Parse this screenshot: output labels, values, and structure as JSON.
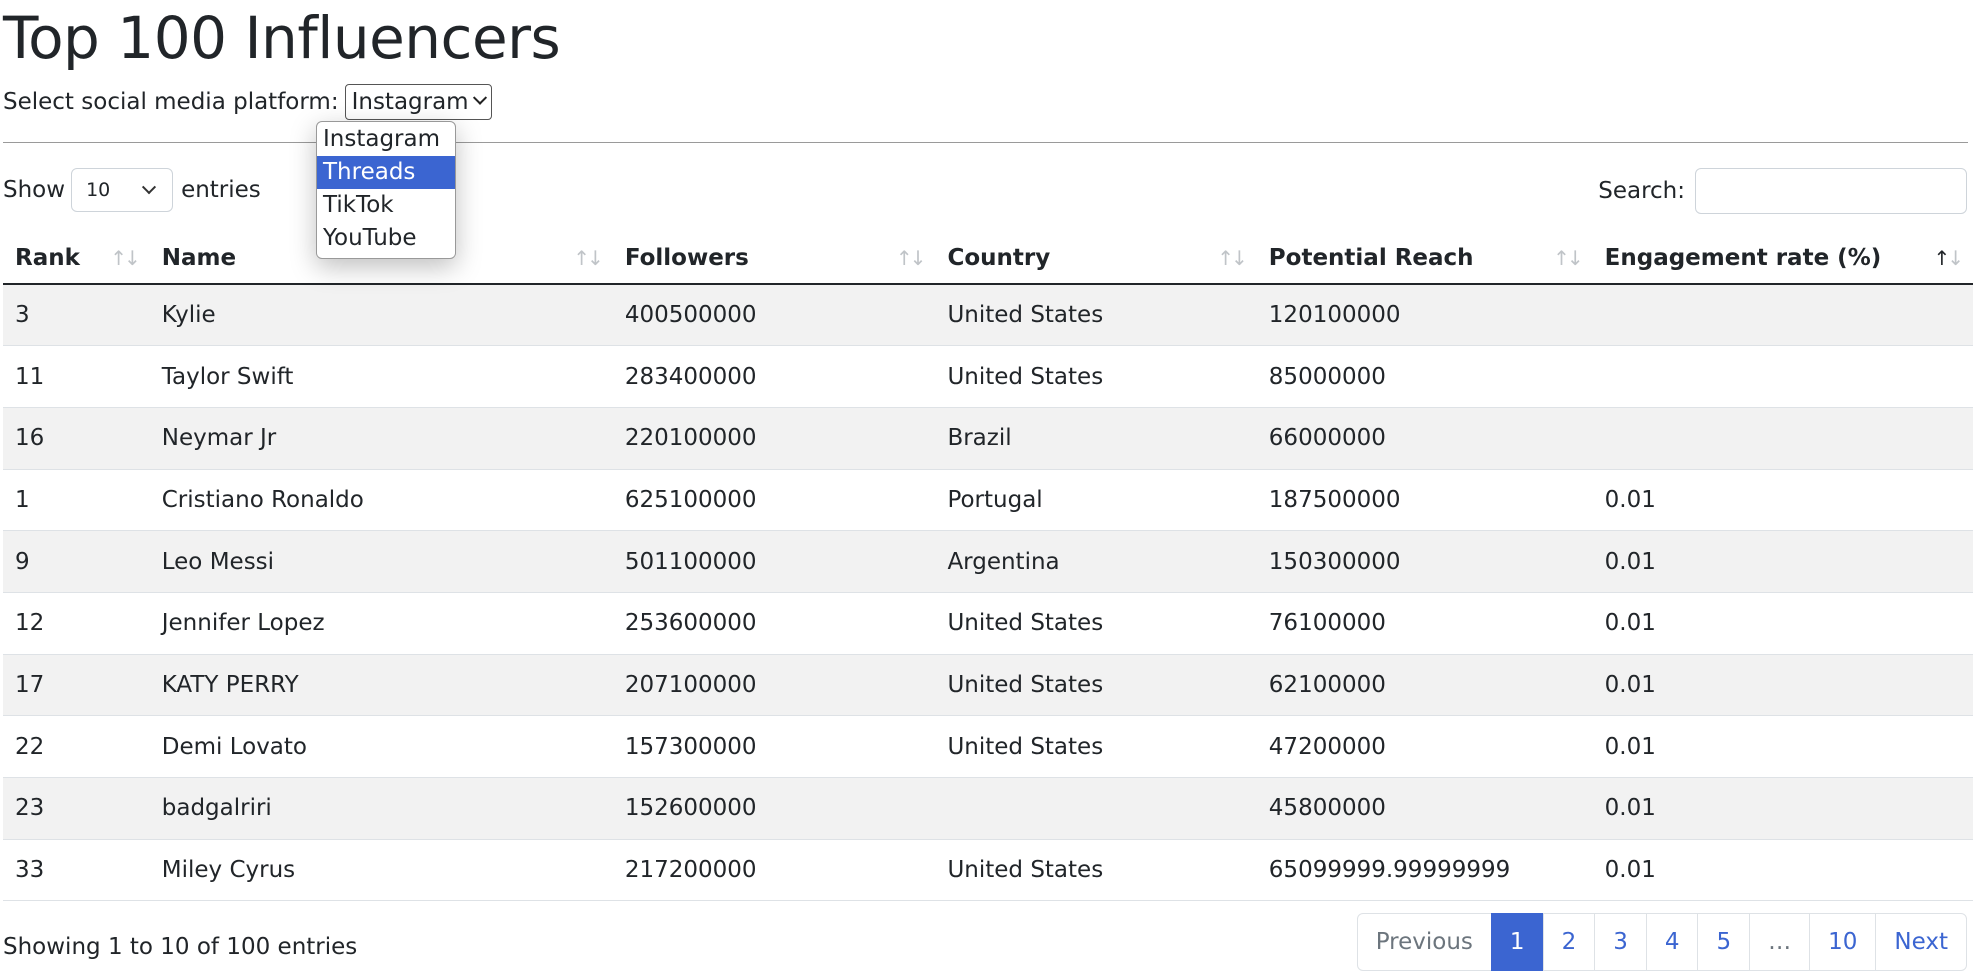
{
  "page": {
    "title": "Top 100 Influencers"
  },
  "platform": {
    "label": "Select social media platform:",
    "selected": "Instagram",
    "options": [
      "Instagram",
      "Threads",
      "TikTok",
      "YouTube"
    ],
    "highlighted_option": "Threads"
  },
  "length_control": {
    "show_label": "Show",
    "value": "10",
    "entries_label": "entries"
  },
  "search": {
    "label": "Search:",
    "value": ""
  },
  "table": {
    "columns": [
      "Rank",
      "Name",
      "Followers",
      "Country",
      "Potential Reach",
      "Engagement rate (%)"
    ],
    "sorted_column": "Engagement rate (%)",
    "sort_direction": "ascending",
    "rows": [
      [
        "3",
        "Kylie",
        "400500000",
        "United States",
        "120100000",
        ""
      ],
      [
        "11",
        "Taylor Swift",
        "283400000",
        "United States",
        "85000000",
        ""
      ],
      [
        "16",
        "Neymar Jr",
        "220100000",
        "Brazil",
        "66000000",
        ""
      ],
      [
        "1",
        "Cristiano Ronaldo",
        "625100000",
        "Portugal",
        "187500000",
        "0.01"
      ],
      [
        "9",
        "Leo Messi",
        "501100000",
        "Argentina",
        "150300000",
        "0.01"
      ],
      [
        "12",
        "Jennifer Lopez",
        "253600000",
        "United States",
        "76100000",
        "0.01"
      ],
      [
        "17",
        "KATY PERRY",
        "207100000",
        "United States",
        "62100000",
        "0.01"
      ],
      [
        "22",
        "Demi Lovato",
        "157300000",
        "United States",
        "47200000",
        "0.01"
      ],
      [
        "23",
        "badgalriri",
        "152600000",
        "",
        "45800000",
        "0.01"
      ],
      [
        "33",
        "Miley Cyrus",
        "217200000",
        "United States",
        "65099999.99999999",
        "0.01"
      ]
    ]
  },
  "footer": {
    "info": "Showing 1 to 10 of 100 entries",
    "pagination": [
      "Previous",
      "1",
      "2",
      "3",
      "4",
      "5",
      "…",
      "10",
      "Next"
    ],
    "active_page": "1"
  },
  "colors": {
    "accent": "#3b65d1",
    "stripe": "#f2f2f2",
    "text": "#212529"
  }
}
